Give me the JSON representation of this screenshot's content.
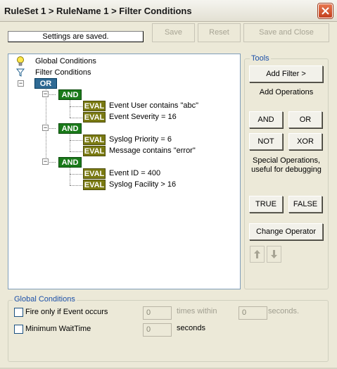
{
  "window": {
    "title": "RuleSet 1 > RuleName 1 > Filter Conditions",
    "close_icon": "close-icon"
  },
  "status": "Settings are saved.",
  "toolbar": {
    "save_label": "Save",
    "reset_label": "Reset",
    "save_close_label": "Save and Close"
  },
  "tree": {
    "global_conditions_label": "Global Conditions",
    "filter_conditions_label": "Filter Conditions",
    "root_operator": "OR",
    "groups": [
      {
        "operator": "AND",
        "items": [
          {
            "tag": "EVAL",
            "text": "Event User contains \"abc\""
          },
          {
            "tag": "EVAL",
            "text": "Event Severity = 16"
          }
        ]
      },
      {
        "operator": "AND",
        "items": [
          {
            "tag": "EVAL",
            "text": "Syslog Priority = 6"
          },
          {
            "tag": "EVAL",
            "text": "Message contains \"error\""
          }
        ]
      },
      {
        "operator": "AND",
        "items": [
          {
            "tag": "EVAL",
            "text": "Event ID = 400"
          },
          {
            "tag": "EVAL",
            "text": "Syslog Facility > 16"
          }
        ]
      }
    ]
  },
  "tools": {
    "legend": "Tools",
    "add_filter_label": "Add Filter >",
    "add_operations_label": "Add Operations",
    "and_label": "AND",
    "or_label": "OR",
    "not_label": "NOT",
    "xor_label": "XOR",
    "special_operations_text": "Special Operations, useful for debugging",
    "true_label": "TRUE",
    "false_label": "FALSE",
    "change_operator_label": "Change Operator",
    "move_up_icon": "arrow-up-icon",
    "move_down_icon": "arrow-down-icon"
  },
  "global_conditions": {
    "legend": "Global Conditions",
    "fire_only_label": "Fire only if Event occurs",
    "fire_only_checked": false,
    "times_value": "0",
    "times_within_label": "times within",
    "seconds_value": "0",
    "seconds_label": "seconds.",
    "min_wait_label": "Minimum WaitTime",
    "min_wait_checked": false,
    "min_wait_value": "0",
    "min_wait_seconds_label": "seconds"
  },
  "colors": {
    "or_node": "#2f6a94",
    "and_node": "#1a7a1a",
    "eval_node": "#7a7a12",
    "legend_text": "#1b4fa8",
    "close_button": "#c3401d"
  }
}
